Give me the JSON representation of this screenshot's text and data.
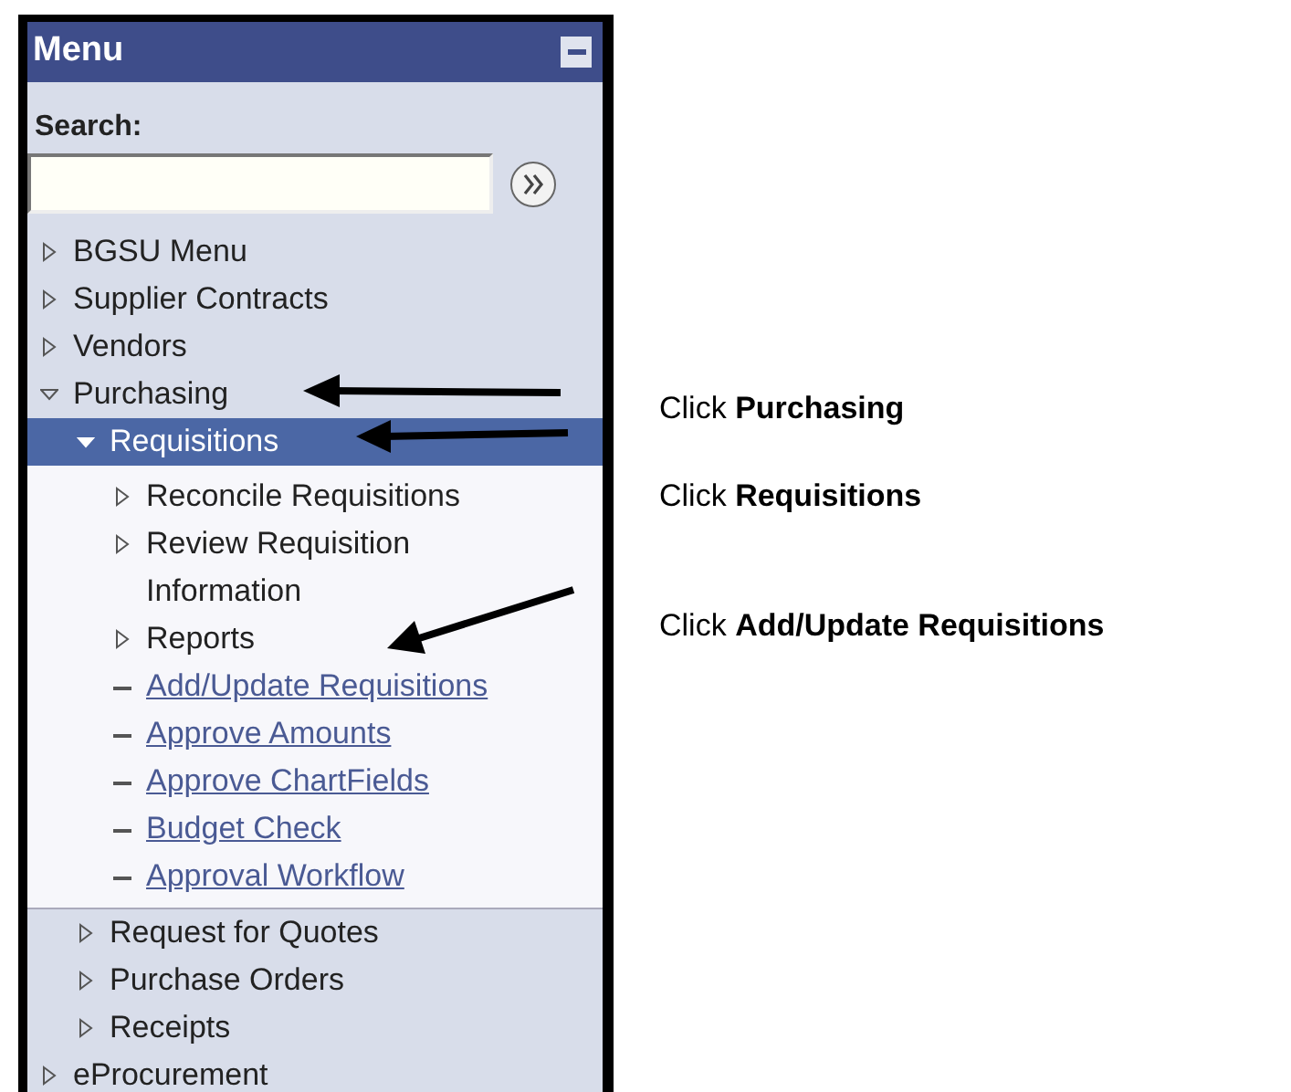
{
  "menu_panel": {
    "title": "Menu",
    "search": {
      "label": "Search:"
    },
    "tree": [
      {
        "kind": "folder",
        "label": "BGSU Menu",
        "expanded": false,
        "selected": false
      },
      {
        "kind": "folder",
        "label": "Supplier Contracts",
        "expanded": false,
        "selected": false
      },
      {
        "kind": "folder",
        "label": "Vendors",
        "expanded": false,
        "selected": false
      },
      {
        "kind": "folder",
        "label": "Purchasing",
        "expanded": true,
        "selected": false,
        "children": [
          {
            "kind": "folder",
            "label": "Requisitions",
            "expanded": true,
            "selected": true,
            "children": [
              {
                "kind": "folder",
                "label": "Reconcile Requisitions",
                "expanded": false,
                "selected": false
              },
              {
                "kind": "folder",
                "label": "Review Requisition Information",
                "expanded": false,
                "selected": false
              },
              {
                "kind": "folder",
                "label": "Reports",
                "expanded": false,
                "selected": false
              },
              {
                "kind": "link",
                "label": "Add/Update Requisitions",
                "selected": false
              },
              {
                "kind": "link",
                "label": "Approve Amounts",
                "selected": false
              },
              {
                "kind": "link",
                "label": "Approve ChartFields",
                "selected": false
              },
              {
                "kind": "link",
                "label": "Budget Check",
                "selected": false
              },
              {
                "kind": "link",
                "label": "Approval Workflow",
                "selected": false
              }
            ]
          },
          {
            "kind": "folder",
            "label": "Request for Quotes",
            "expanded": false,
            "selected": false
          },
          {
            "kind": "folder",
            "label": "Purchase Orders",
            "expanded": false,
            "selected": false
          },
          {
            "kind": "folder",
            "label": "Receipts",
            "expanded": false,
            "selected": false
          }
        ]
      },
      {
        "kind": "folder",
        "label": "eProcurement",
        "expanded": false,
        "selected": false
      }
    ]
  },
  "instructions": [
    {
      "text": "Click **Purchasing**"
    },
    {
      "text": "Click **Requisitions**"
    },
    {
      "text": "Click **Add/Update Requisitions**"
    }
  ]
}
